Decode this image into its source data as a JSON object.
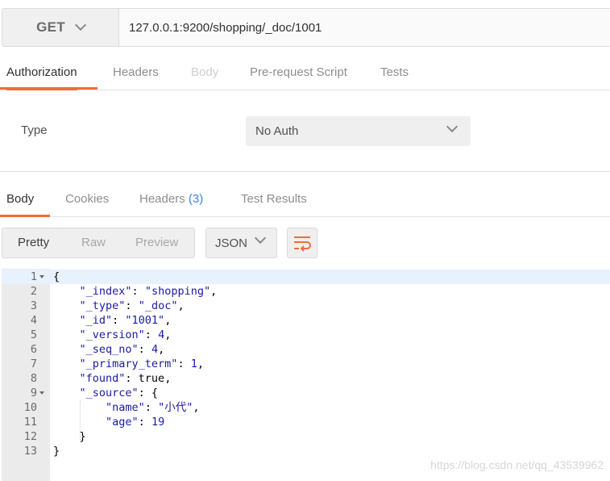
{
  "request": {
    "method": "GET",
    "url": "127.0.0.1:9200/shopping/_doc/1001"
  },
  "request_tabs": [
    {
      "label": "Authorization",
      "state": "active"
    },
    {
      "label": "Headers",
      "state": "normal"
    },
    {
      "label": "Body",
      "state": "disabled"
    },
    {
      "label": "Pre-request Script",
      "state": "normal"
    },
    {
      "label": "Tests",
      "state": "normal"
    }
  ],
  "auth": {
    "type_label": "Type",
    "type_value": "No Auth"
  },
  "response_tabs": {
    "body": "Body",
    "cookies": "Cookies",
    "headers": "Headers",
    "headers_count": "(3)",
    "test_results": "Test Results"
  },
  "view_modes": [
    "Pretty",
    "Raw",
    "Preview"
  ],
  "format": "JSON",
  "code": {
    "numbers": [
      "1",
      "2",
      "3",
      "4",
      "5",
      "6",
      "7",
      "8",
      "9",
      "10",
      "11",
      "12",
      "13"
    ],
    "lines": [
      "{",
      "    \"_index\": \"shopping\",",
      "    \"_type\": \"_doc\",",
      "    \"_id\": \"1001\",",
      "    \"_version\": 4,",
      "    \"_seq_no\": 4,",
      "    \"_primary_term\": 1,",
      "    \"found\": true,",
      "    \"_source\": {",
      "        \"name\": \"小代\",",
      "        \"age\": 19",
      "    }",
      "}"
    ]
  },
  "watermark": "https://blog.csdn.net/qq_43539962",
  "colors": {
    "accent": "#f26b3a",
    "link": "#3d86d9",
    "json_value": "#1a1aa6"
  },
  "icons": {
    "method_dropdown": "chevron-down-icon",
    "auth_dropdown": "chevron-down-icon",
    "format_dropdown": "chevron-down-icon",
    "wrap": "wrap-lines-icon"
  }
}
